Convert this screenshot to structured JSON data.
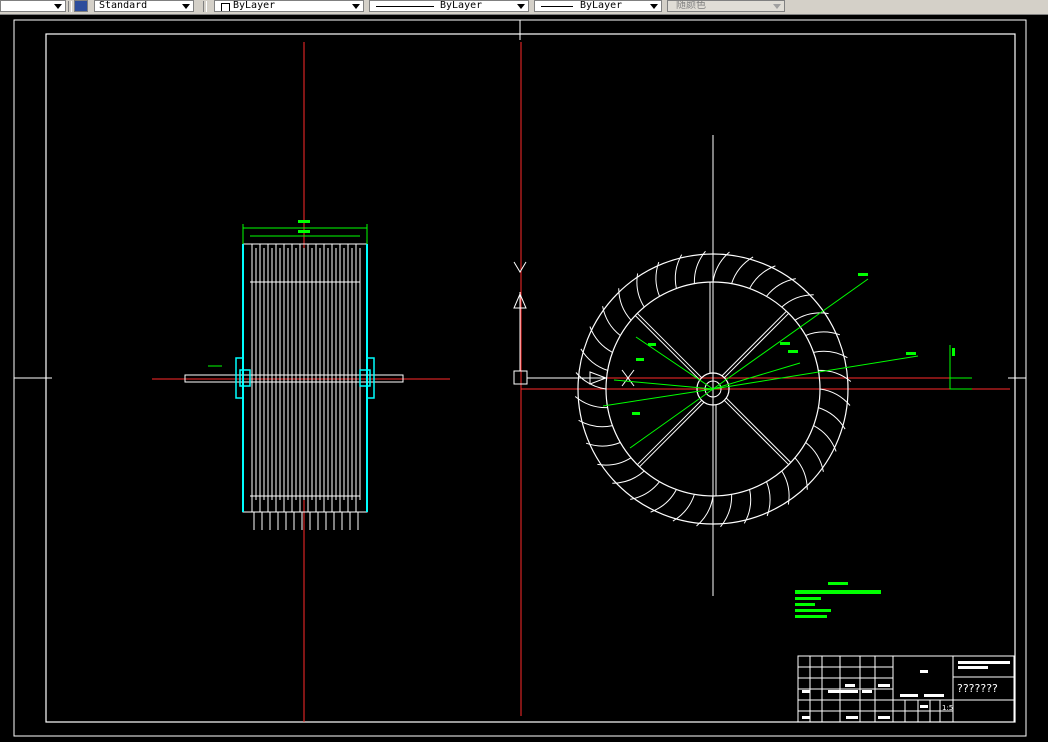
{
  "toolbar": {
    "dimstyle_value": "Standard",
    "layer_value": "ByLayer",
    "linetype_value": "ByLayer",
    "lineweight_value": "ByLayer",
    "plotstyle_value": "随颜色"
  },
  "drawing": {
    "title_block": {
      "drawing_name": "???????",
      "scale": "1:5"
    }
  },
  "colors": {
    "background": "#000000",
    "geometry": "#ffffff",
    "centerline": "#ff0000",
    "dimension": "#00ff00",
    "bearing_cyan": "#00ffff"
  }
}
